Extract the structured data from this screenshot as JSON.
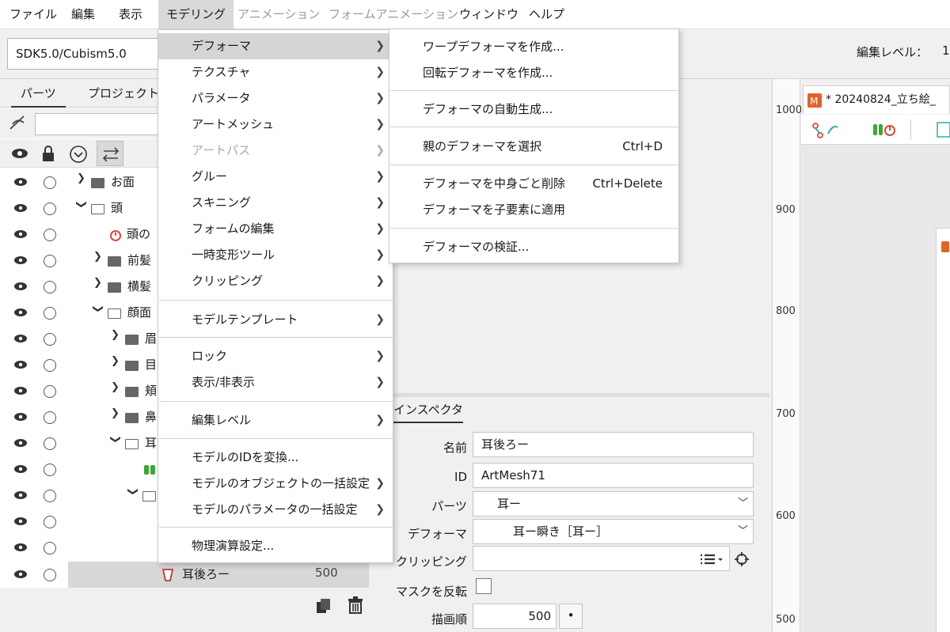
{
  "menubar": [
    "ファイル",
    "編集",
    "表示",
    "モデリング",
    "アニメーション",
    "フォームアニメーション",
    "ウィンドウ",
    "ヘルプ"
  ],
  "toolbar": {
    "sdk_combo": "SDK5.0/Cubism5.0",
    "edit_level_label": "編集レベル：",
    "edit_level_value": "1"
  },
  "left_panel": {
    "tabs": [
      "パーツ",
      "プロジェクト"
    ],
    "tree": [
      {
        "label": "お面"
      },
      {
        "label": "頭"
      },
      {
        "label": "頭の"
      },
      {
        "label": "前髪"
      },
      {
        "label": "横髪"
      },
      {
        "label": "顔面"
      },
      {
        "label": "眉"
      },
      {
        "label": "目"
      },
      {
        "label": "頬"
      },
      {
        "label": "鼻"
      },
      {
        "label": "耳"
      },
      {
        "label": ""
      },
      {
        "label": ""
      },
      {
        "label": ""
      },
      {
        "label": ""
      }
    ],
    "selected": {
      "label": "耳後ろー",
      "value": "500"
    }
  },
  "modeling_menu": {
    "items": [
      "デフォーマ",
      "テクスチャ",
      "パラメータ",
      "アートメッシュ",
      "アートパス",
      "グルー",
      "スキニング",
      "フォームの編集",
      "一時変形ツール",
      "クリッピング",
      "モデルテンプレート",
      "ロック",
      "表示/非表示",
      "編集レベル",
      "モデルのIDを変換...",
      "モデルのオブジェクトの一括設定",
      "モデルのパラメータの一括設定",
      "物理演算設定..."
    ]
  },
  "deformer_submenu": {
    "items": [
      {
        "label": "ワープデフォーマを作成...",
        "shortcut": ""
      },
      {
        "label": "回転デフォーマを作成...",
        "shortcut": ""
      },
      {
        "label": "デフォーマの自動生成...",
        "shortcut": ""
      },
      {
        "label": "親のデフォーマを選択",
        "shortcut": "Ctrl+D"
      },
      {
        "label": "デフォーマを中身ごと削除",
        "shortcut": "Ctrl+Delete"
      },
      {
        "label": "デフォーマを子要素に適用",
        "shortcut": ""
      },
      {
        "label": "デフォーマの検証...",
        "shortcut": ""
      }
    ]
  },
  "inspector": {
    "tab": "インスペクタ",
    "name_label": "名前",
    "name_value": "耳後ろー",
    "id_label": "ID",
    "id_value": "ArtMesh71",
    "parts_label": "パーツ",
    "parts_value": "耳ー",
    "deformer_label": "デフォーマ",
    "deformer_value": "耳ー瞬き［耳ー］",
    "clipping_label": "クリッピング",
    "mask_label": "マスクを反転",
    "draw_order_label": "描画順",
    "draw_order_value": "500"
  },
  "viewer": {
    "tab_title": "* 20240824_立ち絵_",
    "ruler": [
      "1000",
      "900",
      "800",
      "700",
      "600",
      "500"
    ]
  },
  "colors": {
    "menu_highlight": "#d5d5d5",
    "icon_red": "#e0453a",
    "icon_green": "#3aa83a",
    "icon_teal": "#2bb0a8"
  }
}
